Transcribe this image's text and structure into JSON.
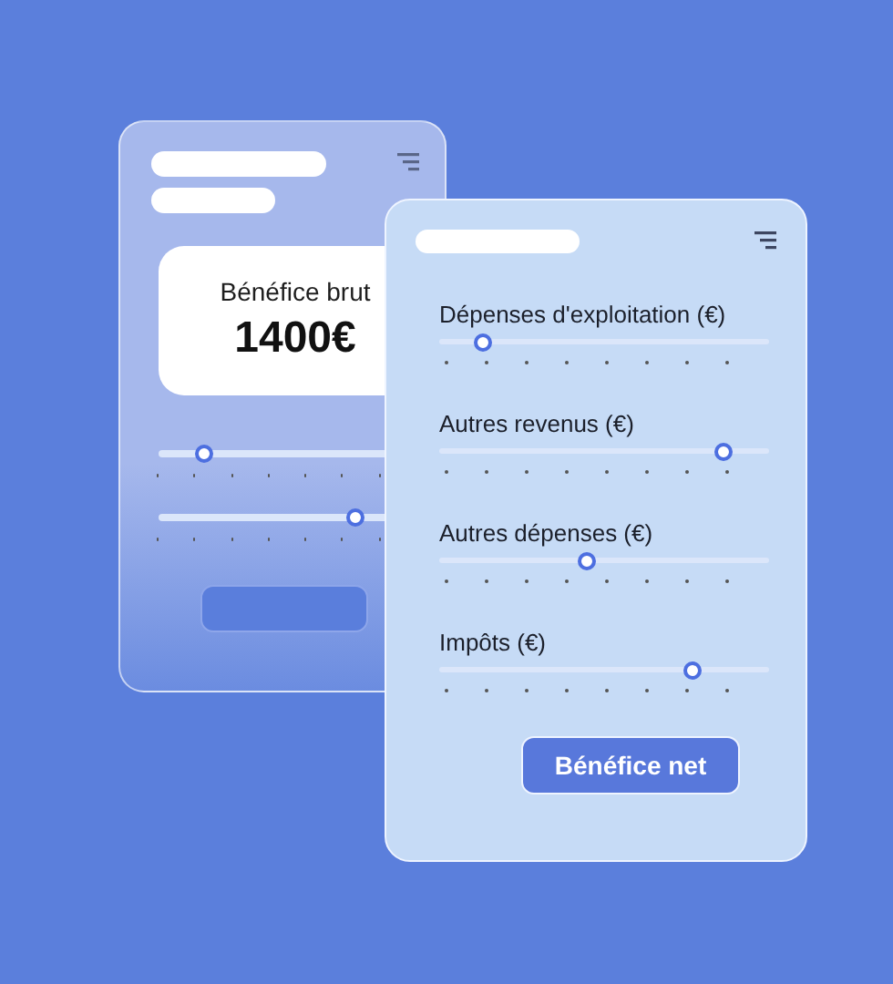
{
  "back_card": {
    "summary_label": "Bénéfice brut",
    "summary_value": "1400€",
    "sliders": [
      {
        "level": 0.2
      },
      {
        "level": 0.87
      }
    ]
  },
  "front_card": {
    "sliders": [
      {
        "label": "Dépenses d'exploitation (€)",
        "level": 0.13
      },
      {
        "label": "Autres revenus (€)",
        "level": 0.86
      },
      {
        "label": "Autres dépenses (€)",
        "level": 0.45
      },
      {
        "label": "Impôts (€)",
        "level": 0.77
      }
    ],
    "button": "Bénéfice net"
  }
}
